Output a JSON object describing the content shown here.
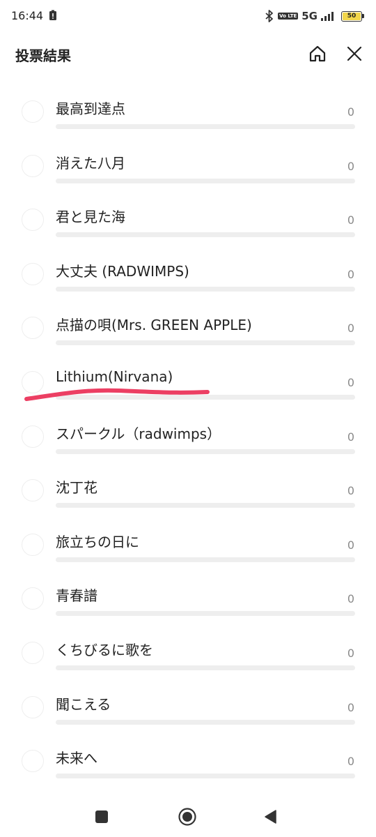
{
  "status_bar": {
    "time": "16:44",
    "volte": "Vo LTE",
    "network": "5G",
    "battery_level": "50",
    "battery_color": "#f2d64b",
    "icons": [
      "sim-alert-icon",
      "bluetooth-icon",
      "volte-icon",
      "signal-icon",
      "battery-icon"
    ]
  },
  "header": {
    "title": "投票結果",
    "icons": [
      "home-icon",
      "close-icon"
    ]
  },
  "poll": {
    "options": [
      {
        "label": "最高到達点",
        "count": "0",
        "ratio": 0
      },
      {
        "label": "消えた八月",
        "count": "0",
        "ratio": 0
      },
      {
        "label": "君と見た海",
        "count": "0",
        "ratio": 0
      },
      {
        "label": "大丈夫 (RADWIMPS)",
        "count": "0",
        "ratio": 0
      },
      {
        "label": "点描の唄(Mrs. GREEN APPLE)",
        "count": "0",
        "ratio": 0
      },
      {
        "label": "Lithium(Nirvana)",
        "count": "0",
        "ratio": 0,
        "highlighted": true
      },
      {
        "label": "スパークル（radwimps）",
        "count": "0",
        "ratio": 0
      },
      {
        "label": "沈丁花",
        "count": "0",
        "ratio": 0
      },
      {
        "label": "旅立ちの日に",
        "count": "0",
        "ratio": 0
      },
      {
        "label": "青春譜",
        "count": "0",
        "ratio": 0
      },
      {
        "label": "くちびるに歌を",
        "count": "0",
        "ratio": 0
      },
      {
        "label": "聞こえる",
        "count": "0",
        "ratio": 0
      },
      {
        "label": "未来へ",
        "count": "0",
        "ratio": 0
      }
    ],
    "highlight_color": "#ec3f63"
  },
  "nav_bar": {
    "icons": [
      "recent-apps-icon",
      "home-nav-icon",
      "back-icon"
    ]
  }
}
